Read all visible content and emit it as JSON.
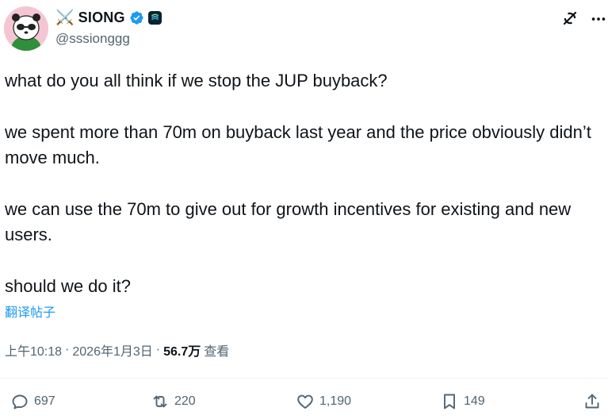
{
  "author": {
    "emoji": "⚔️",
    "display_name": "SIONG",
    "handle": "@sssionggg"
  },
  "tweet": {
    "paragraphs": [
      "what do you all think if we stop the JUP buyback?",
      "we spent more than 70m on buyback last year and the price obviously didn’t move much.",
      "we can use the 70m to give out for growth incentives for existing and new users.",
      "should we do it?"
    ],
    "translate_label": "翻译帖子"
  },
  "meta": {
    "time": "上午10:18",
    "separator": "·",
    "date": "2026年1月3日",
    "views_count": "56.7万",
    "views_label": "查看"
  },
  "actions": {
    "replies": "697",
    "reposts": "220",
    "likes": "1,190",
    "bookmarks": "149"
  },
  "colors": {
    "accent": "#1d9bf0",
    "secondary_text": "#536471",
    "avatar_bg": "#f4c6d4"
  },
  "icons": [
    "verified-badge-icon",
    "grok-icon",
    "more-icon",
    "reply-icon",
    "repost-icon",
    "like-icon",
    "bookmark-icon",
    "share-icon"
  ]
}
